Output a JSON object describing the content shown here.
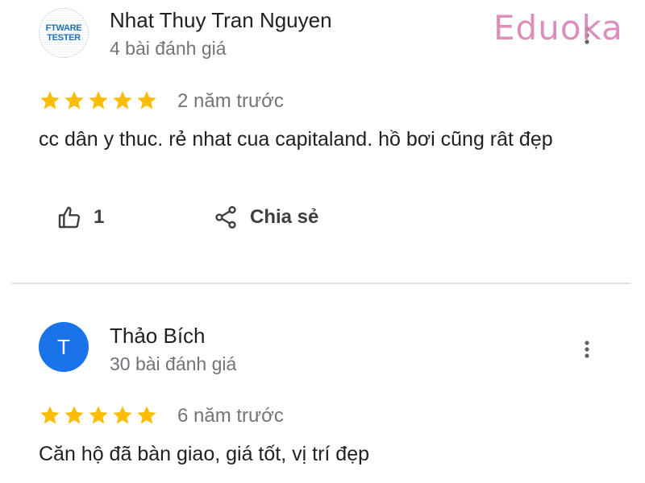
{
  "watermark": "Eduoka",
  "reviews": [
    {
      "author": "Nhat Thuy Tran Nguyen",
      "review_count": "4 bài đánh giá",
      "avatar_logo_line1": "FTWARE",
      "avatar_logo_line2": "TESTER",
      "rating": 5,
      "time": "2 năm trước",
      "text": "cc dân y thuc. rẻ nhat cua capitaland. hồ bơi cũng rât đẹp",
      "like_count": "1",
      "share_label": "Chia sẻ"
    },
    {
      "author": "Thảo Bích",
      "review_count": "30 bài đánh giá",
      "avatar_initial": "T",
      "avatar_color": "#1a73e8",
      "rating": 5,
      "time": "6 năm trước",
      "text": "Căn hộ đã bàn giao, giá tốt, vị trí đẹp"
    }
  ],
  "colors": {
    "star": "#fbbc04",
    "secondary_text": "#70757a",
    "watermark": "#d982b5"
  },
  "icons": [
    "thumbs-up-icon",
    "share-icon",
    "more-vert-icon",
    "star-icon"
  ]
}
